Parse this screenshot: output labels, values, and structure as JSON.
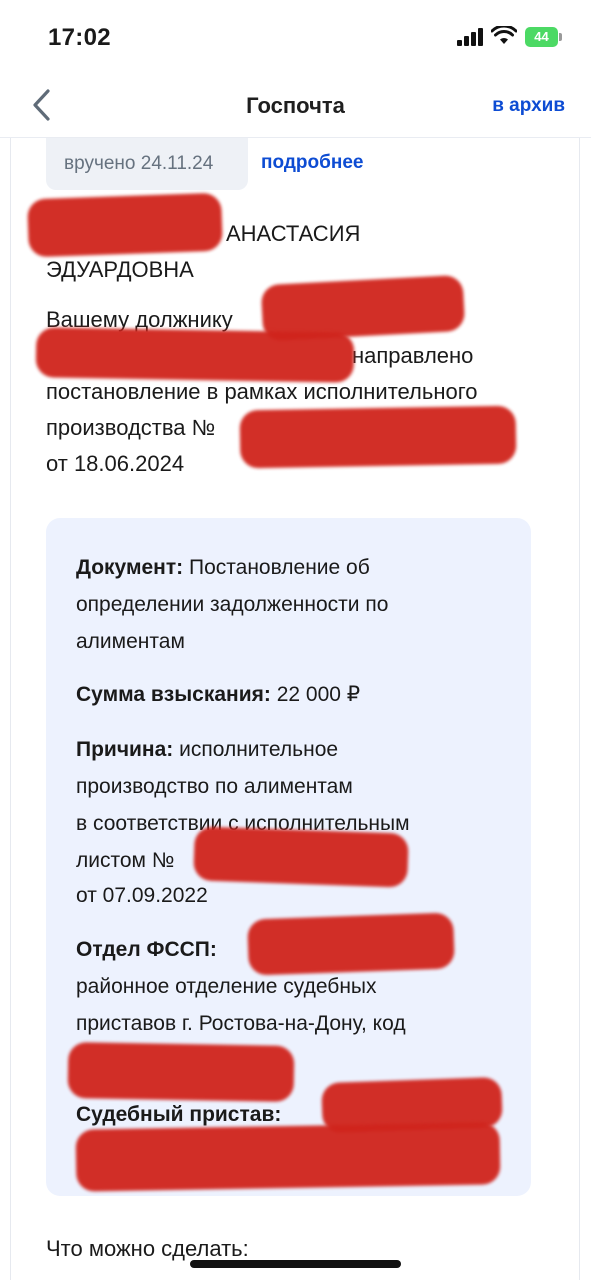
{
  "status": {
    "time": "17:02",
    "battery": "44"
  },
  "nav": {
    "title": "Госпочта",
    "archive_label": "в архив"
  },
  "message": {
    "delivered_badge": "вручено 24.11.24",
    "details_link": "подробнее",
    "recipient_line1": "АНАСТАСИЯ",
    "recipient_line2": "ЭДУАРДОВНА",
    "body_line1": "Вашему должнику",
    "body_line2": "направлено",
    "body_line3": "постановление в рамках исполнительного",
    "body_line4": "производства №",
    "body_line5": "от 18.06.2024"
  },
  "details": {
    "document_label": "Документ:",
    "document_value_1": "Постановление об",
    "document_value_2": "определении задолженности по",
    "document_value_3": "алиментам",
    "amount_label": "Сумма взыскания:",
    "amount_value": "22 000 ₽",
    "reason_label": "Причина:",
    "reason_value_1": "исполнительное",
    "reason_value_2": "производство по алиментам",
    "reason_value_3": "в соответствии с исполнительным",
    "reason_value_4": "листом №",
    "reason_value_5": "от 07.09.2022",
    "department_label": "Отдел ФССП:",
    "department_value_1": "районное отделение судебных",
    "department_value_2": "приставов г. Ростова-на-Дону, код",
    "bailiff_label": "Судебный пристав:"
  },
  "footer": {
    "actions_heading": "Что можно сделать:"
  },
  "colors": {
    "accent": "#0d4cd3",
    "info_bg": "#edf2fe",
    "redaction": "#d0241c"
  }
}
